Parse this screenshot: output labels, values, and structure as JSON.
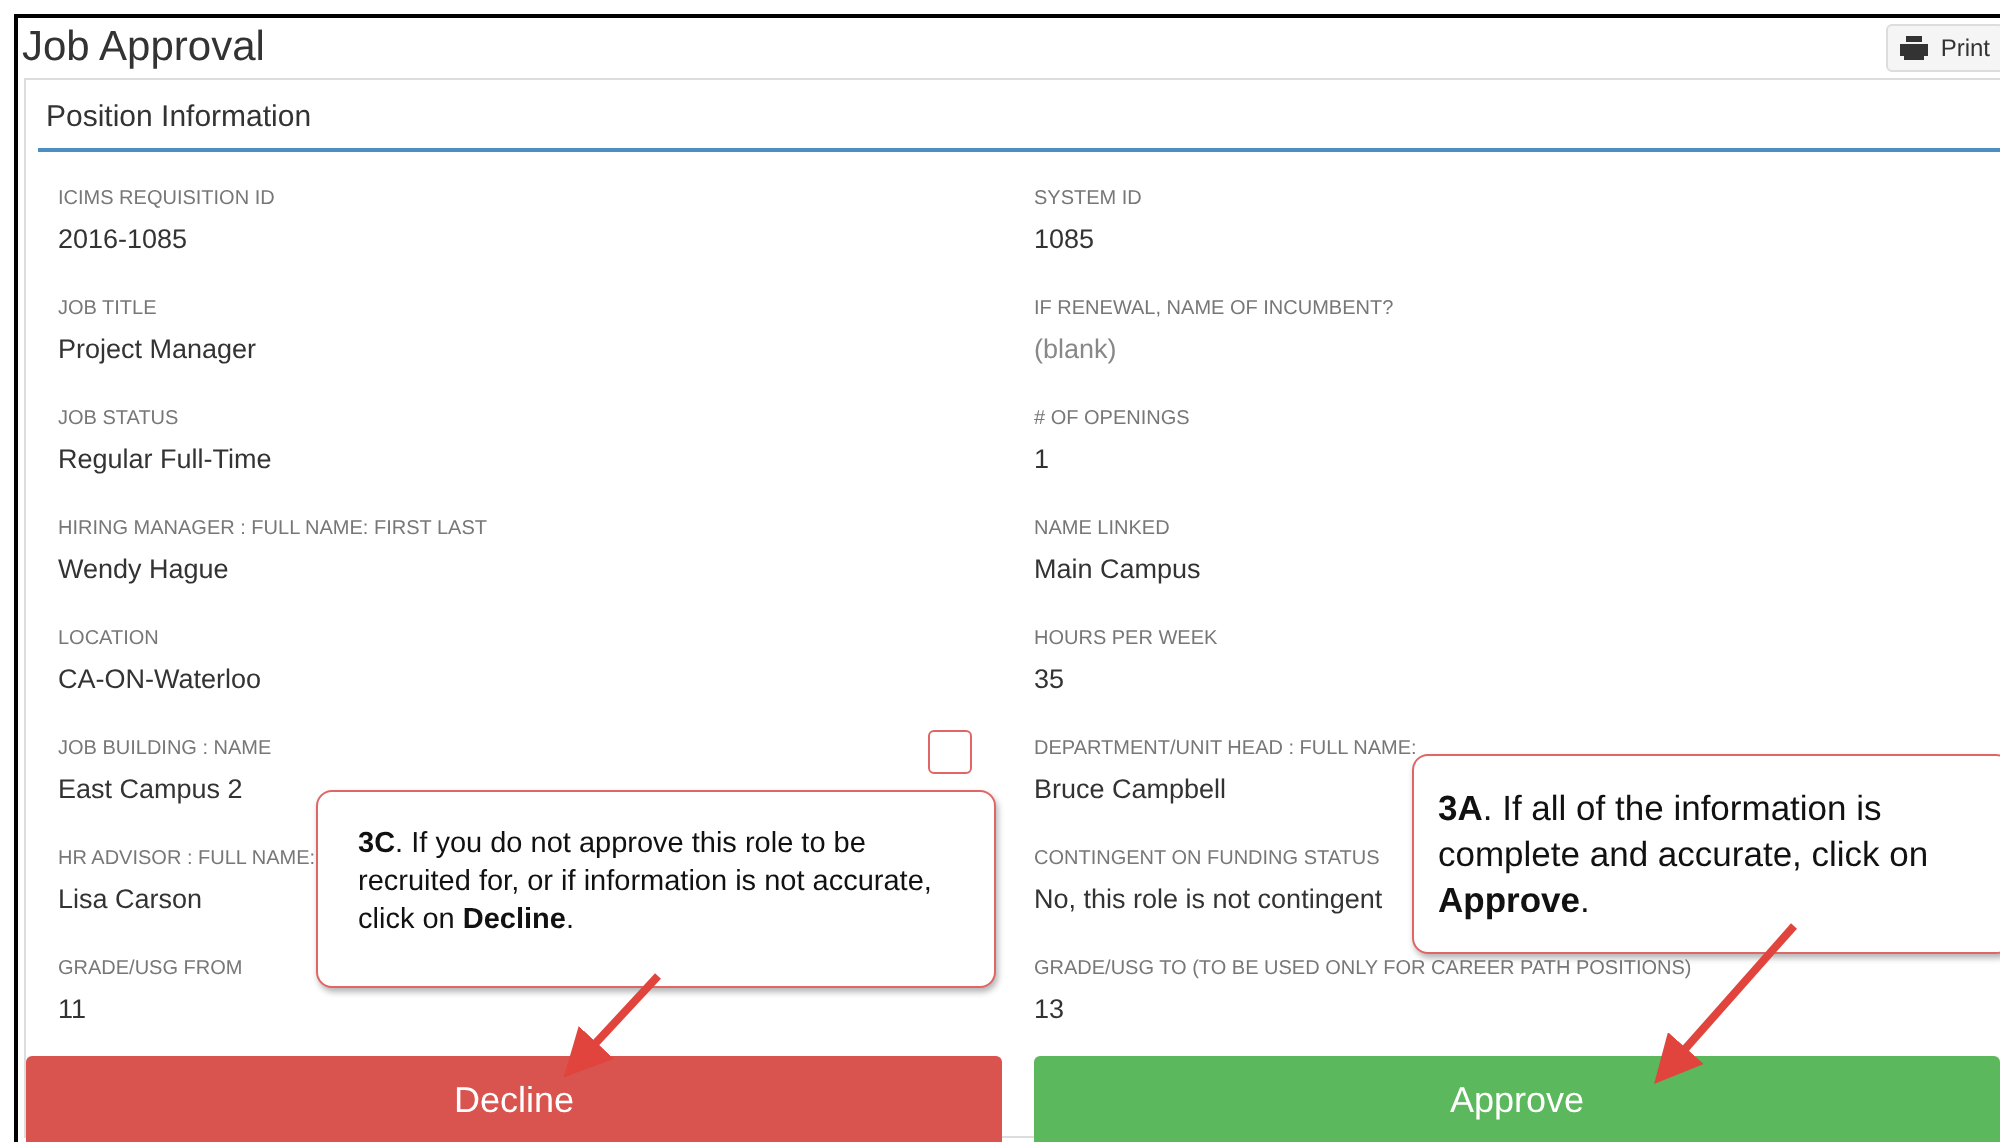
{
  "page": {
    "title": "Job Approval",
    "print_button": "Print"
  },
  "panel": {
    "title": "Position Information"
  },
  "fields": [
    {
      "label": "ICIMS REQUISITION ID",
      "value": "2016-1085",
      "empty": false
    },
    {
      "label": "SYSTEM ID",
      "value": "1085",
      "empty": false
    },
    {
      "label": "JOB TITLE",
      "value": "Project Manager",
      "empty": false
    },
    {
      "label": "IF RENEWAL, NAME OF INCUMBENT?",
      "value": "(blank)",
      "empty": true
    },
    {
      "label": "JOB STATUS",
      "value": "Regular Full-Time",
      "empty": false
    },
    {
      "label": "# OF OPENINGS",
      "value": "1",
      "empty": false
    },
    {
      "label": "HIRING MANAGER : FULL NAME: FIRST LAST",
      "value": "Wendy Hague",
      "empty": false
    },
    {
      "label": "NAME LINKED",
      "value": "Main Campus",
      "empty": false
    },
    {
      "label": "LOCATION",
      "value": "CA-ON-Waterloo",
      "empty": false
    },
    {
      "label": "HOURS PER WEEK",
      "value": "35",
      "empty": false
    },
    {
      "label": "JOB BUILDING : NAME",
      "value": "East Campus 2",
      "empty": false
    },
    {
      "label": "DEPARTMENT/UNIT HEAD : FULL NAME:",
      "value": "Bruce Campbell",
      "empty": false
    },
    {
      "label": "HR ADVISOR : FULL NAME:",
      "value": "Lisa Carson",
      "empty": false
    },
    {
      "label": "CONTINGENT ON FUNDING STATUS",
      "value": "No, this role is not contingent",
      "empty": false
    },
    {
      "label": "GRADE/USG FROM",
      "value": "11",
      "empty": false
    },
    {
      "label": "GRADE/USG TO (TO BE USED ONLY FOR CAREER PATH POSITIONS)",
      "value": "13",
      "empty": false
    }
  ],
  "actions": [
    {
      "label": "Decline",
      "kind": "decline"
    },
    {
      "label": "Approve",
      "kind": "approve"
    }
  ],
  "callouts": [
    {
      "text": "**3C**. If you do not approve this role to be recruited for, or if information is not accurate, click on **Decline**.",
      "kind": "decline"
    },
    {
      "text": "**3A**. If all of the information is complete and accurate, click on **Approve**.",
      "kind": "approve"
    }
  ]
}
